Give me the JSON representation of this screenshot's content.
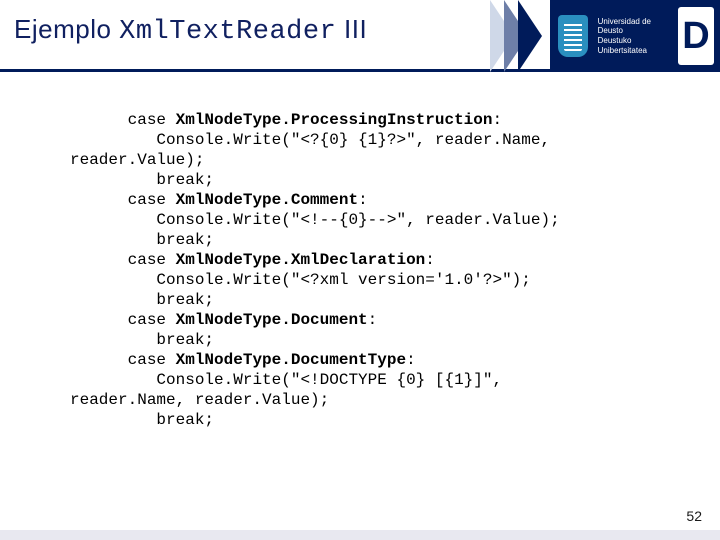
{
  "header": {
    "title_plain": "Ejemplo ",
    "title_mono": "XmlTextReader",
    "title_suffix": " III",
    "uni_line1": "Universidad de Deusto",
    "uni_line2": "Deustuko Unibertsitatea",
    "d_mark": "D"
  },
  "code": {
    "lines": [
      {
        "indent": 2,
        "pre": "case ",
        "bold": "XmlNodeType.ProcessingInstruction",
        "post": ":"
      },
      {
        "indent": 3,
        "pre": "Console.Write(\"<?{0} {1}?>\", reader.Name,",
        "bold": "",
        "post": ""
      },
      {
        "indent": 0,
        "pre": "reader.Value);",
        "bold": "",
        "post": ""
      },
      {
        "indent": 3,
        "pre": "break;",
        "bold": "",
        "post": ""
      },
      {
        "indent": 2,
        "pre": "case ",
        "bold": "XmlNodeType.Comment",
        "post": ":"
      },
      {
        "indent": 3,
        "pre": "Console.Write(\"<!--{0}-->\", reader.Value);",
        "bold": "",
        "post": ""
      },
      {
        "indent": 3,
        "pre": "break;",
        "bold": "",
        "post": ""
      },
      {
        "indent": 2,
        "pre": "case ",
        "bold": "XmlNodeType.XmlDeclaration",
        "post": ":"
      },
      {
        "indent": 3,
        "pre": "Console.Write(\"<?xml version='1.0'?>\");",
        "bold": "",
        "post": ""
      },
      {
        "indent": 3,
        "pre": "break;",
        "bold": "",
        "post": ""
      },
      {
        "indent": 2,
        "pre": "case ",
        "bold": "XmlNodeType.Document",
        "post": ":"
      },
      {
        "indent": 3,
        "pre": "break;",
        "bold": "",
        "post": ""
      },
      {
        "indent": 2,
        "pre": "case ",
        "bold": "XmlNodeType.DocumentType",
        "post": ":"
      },
      {
        "indent": 3,
        "pre": "Console.Write(\"<!DOCTYPE {0} [{1}]\",",
        "bold": "",
        "post": ""
      },
      {
        "indent": 0,
        "pre": "reader.Name, reader.Value);",
        "bold": "",
        "post": ""
      },
      {
        "indent": 3,
        "pre": "break;",
        "bold": "",
        "post": ""
      }
    ]
  },
  "page_number": "52"
}
